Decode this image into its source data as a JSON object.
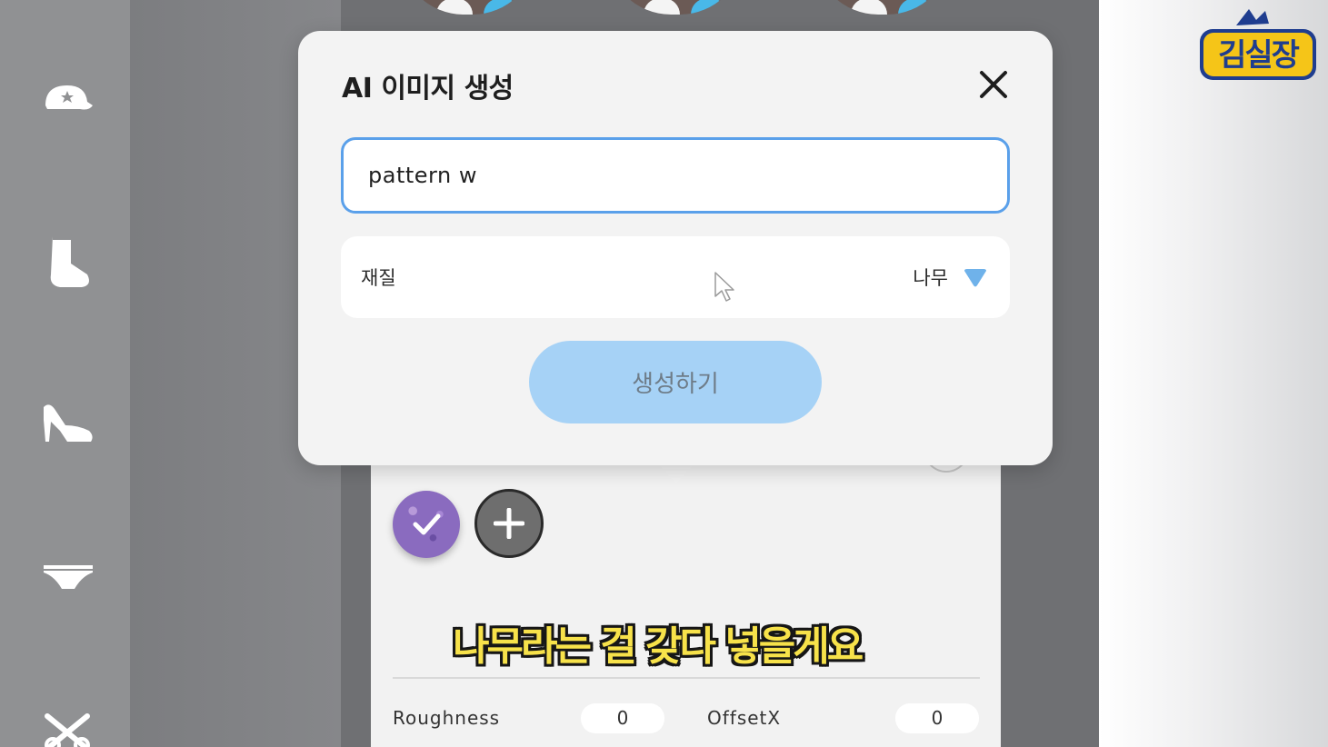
{
  "modal": {
    "title": "AI 이미지 생성",
    "prompt_value": "pattern w",
    "material": {
      "label": "재질",
      "selected": "나무"
    },
    "generate_label": "생성하기"
  },
  "panel": {
    "params": [
      {
        "label": "Roughness",
        "value": "0"
      },
      {
        "label": "OffsetX",
        "value": "0"
      }
    ]
  },
  "subtitle": "나무라는 걸 갖다 넣을게요",
  "sidebar": {
    "icons": [
      "cap-icon",
      "sock-icon",
      "high-heel-icon",
      "underwear-icon",
      "scissors-icon"
    ]
  },
  "logo": {
    "text": "김실장"
  },
  "colors": {
    "accent_blue": "#5aa0ea",
    "button_blue": "#a6d2f6",
    "dropdown_blue": "#6fb2ea",
    "subtitle_yellow": "#f7e24a"
  }
}
